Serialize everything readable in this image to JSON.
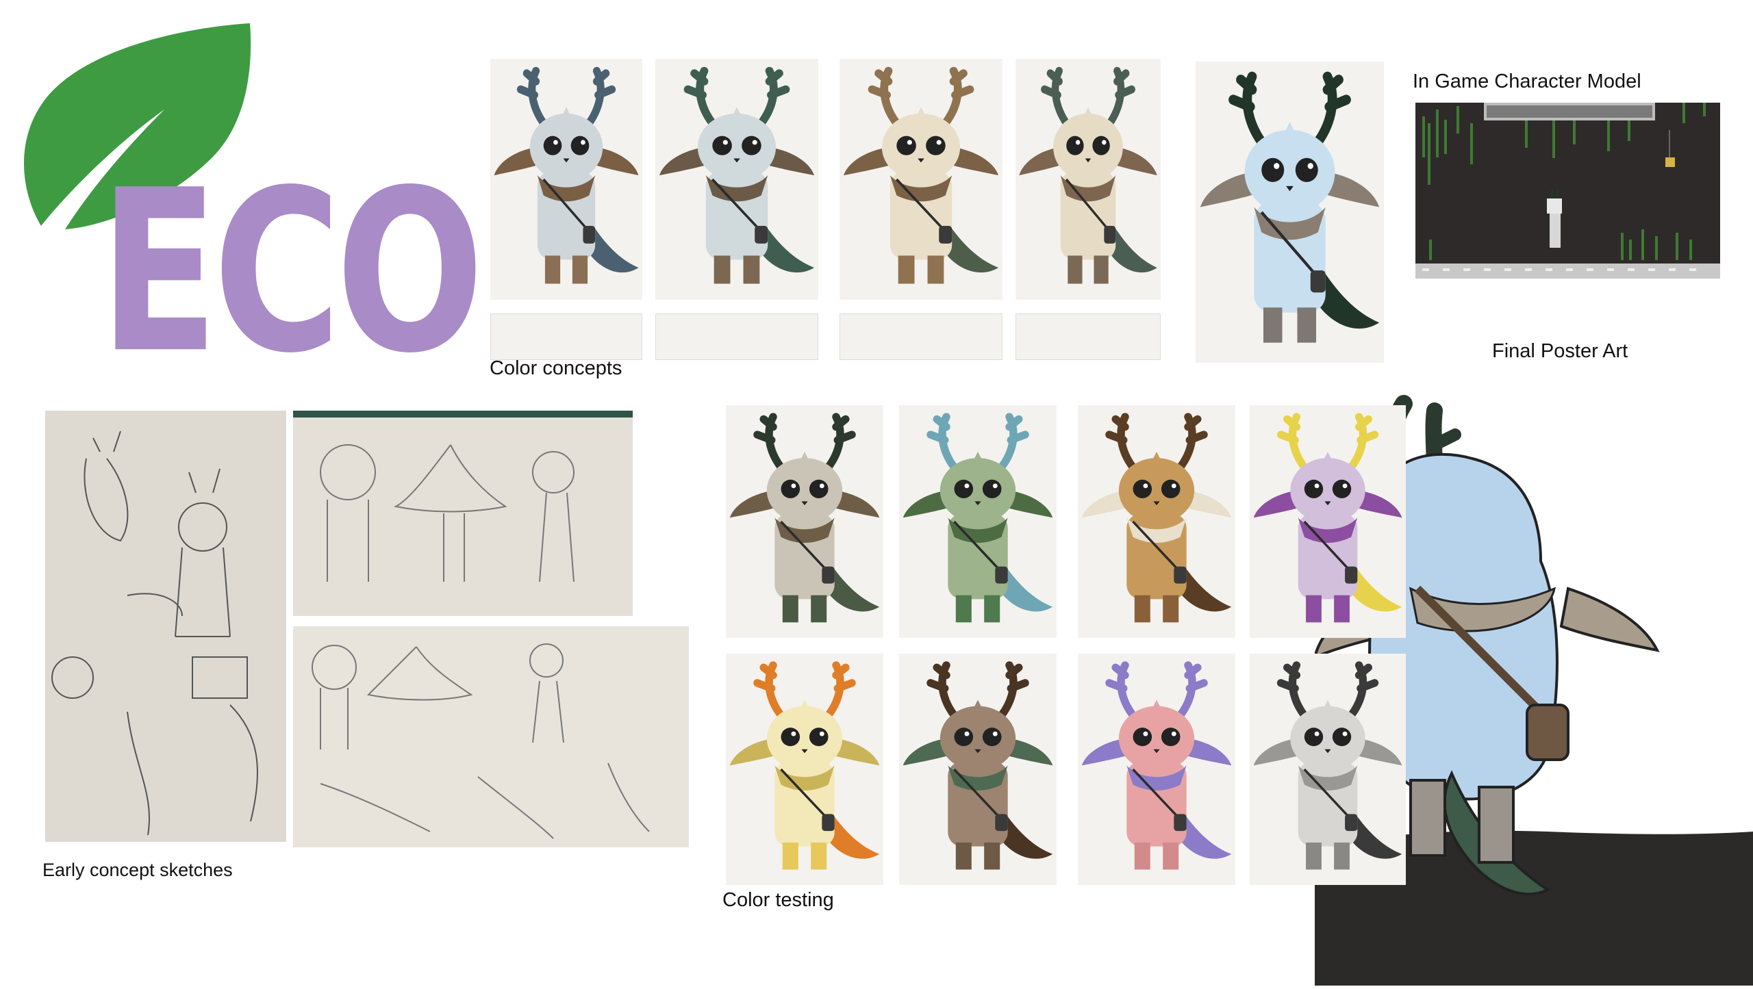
{
  "logo": {
    "text": "ECO",
    "leaf_color": "#3e9b42",
    "text_color": "#a98bc8",
    "icon": "leaf-icon"
  },
  "captions": {
    "color_concepts": "Color concepts",
    "in_game_model": "In Game Character Model",
    "final_poster": "Final Poster Art",
    "early_sketches": "Early concept sketches",
    "color_testing": "Color testing"
  },
  "color_concepts": [
    {
      "body": "#cfd6da",
      "antler": "#4b6172",
      "boots": "#8a6f55",
      "tail": "#4b6172",
      "scarf": "#7a5f45"
    },
    {
      "body": "#d0d9dc",
      "antler": "#3f5e51",
      "boots": "#7b6752",
      "tail": "#3f5e51",
      "scarf": "#6b5a47"
    },
    {
      "body": "#e9dfc8",
      "antler": "#8f7250",
      "boots": "#8f7250",
      "tail": "#4d5f4b",
      "scarf": "#7b6247"
    },
    {
      "body": "#e6dcc6",
      "antler": "#4b5e53",
      "boots": "#7a6955",
      "tail": "#4b5e53",
      "scarf": "#7d6550"
    },
    {
      "body": "#c8dff0",
      "antler": "#213628",
      "boots": "#7e7772",
      "tail": "#213628",
      "scarf": "#8a7e72"
    }
  ],
  "color_testing": [
    {
      "body": "#c9c4b6",
      "antler": "#2c3a2e",
      "boots": "#4a5a44",
      "tail": "#4a5a44",
      "scarf": "#6e5e48"
    },
    {
      "body": "#9cb38c",
      "antler": "#6fa6b5",
      "boots": "#4e7a4d",
      "tail": "#6fa6b5",
      "scarf": "#4e6c43"
    },
    {
      "body": "#c79a5c",
      "antler": "#5a3d25",
      "boots": "#8a6039",
      "tail": "#5a3d25",
      "scarf": "#e8e0cc"
    },
    {
      "body": "#d2bfdc",
      "antler": "#e7d34b",
      "boots": "#8c4ea0",
      "tail": "#e7d34b",
      "scarf": "#8c4ea0"
    },
    {
      "body": "#f3e8b8",
      "antler": "#e07d28",
      "boots": "#e7c85a",
      "tail": "#e07d28",
      "scarf": "#c9b45a"
    },
    {
      "body": "#9c8470",
      "antler": "#4a3424",
      "boots": "#6e5846",
      "tail": "#4a3424",
      "scarf": "#4e6a52"
    },
    {
      "body": "#e7a3a3",
      "antler": "#8b7bc8",
      "boots": "#d38a8a",
      "tail": "#8b7bc8",
      "scarf": "#8b7bc8"
    },
    {
      "body": "#d8d6d2",
      "antler": "#3a3a3a",
      "boots": "#8a8884",
      "tail": "#3a3a3a",
      "scarf": "#9a9894"
    }
  ],
  "colors": {
    "poster_body": "#b7d3ec",
    "poster_ground": "#2b2a28",
    "game_bg": "#2f2a2a",
    "game_foliage": "#3e7a33"
  }
}
